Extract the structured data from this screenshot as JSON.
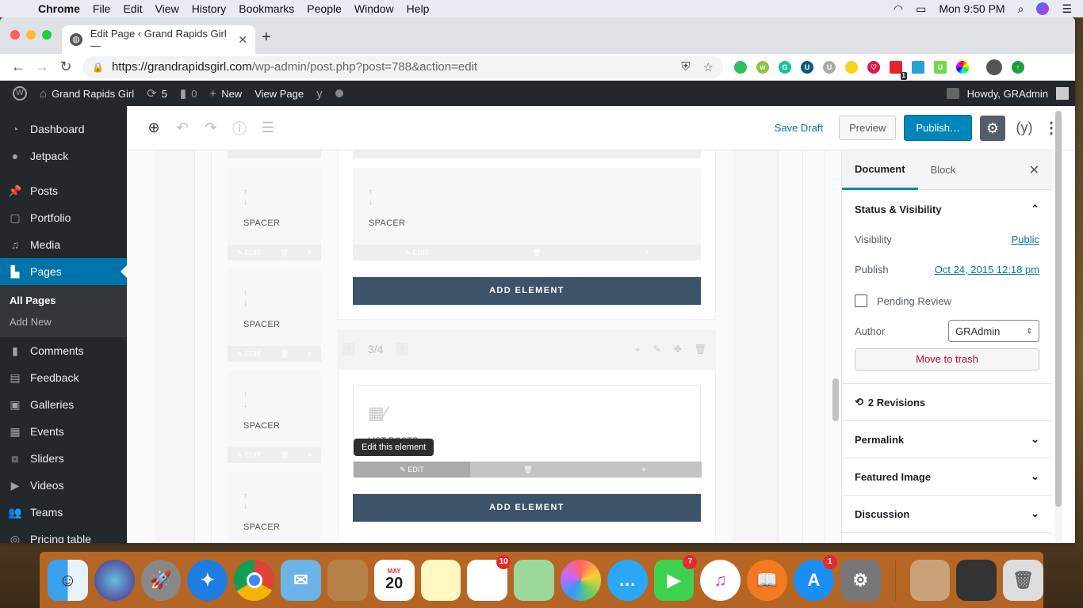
{
  "menubar": {
    "app": "Chrome",
    "items": [
      "File",
      "Edit",
      "View",
      "History",
      "Bookmarks",
      "People",
      "Window",
      "Help"
    ],
    "clock": "Mon 9:50 PM"
  },
  "browser": {
    "tab_title": "Edit Page ‹ Grand Rapids Girl —",
    "url_host": "https://grandrapidsgirl.com",
    "url_path": "/wp-admin/post.php?post=788&action=edit",
    "extension_badge": "1"
  },
  "adminbar": {
    "site_name": "Grand Rapids Girl",
    "updates": "5",
    "comments": "0",
    "new_label": "New",
    "view_page": "View Page",
    "howdy": "Howdy, GRAdmin"
  },
  "sidebar": {
    "items": [
      {
        "label": "Dashboard",
        "icon": "dashboard-icon"
      },
      {
        "label": "Jetpack",
        "icon": "jetpack-icon"
      },
      {
        "label": "Posts",
        "icon": "pin-icon"
      },
      {
        "label": "Portfolio",
        "icon": "portfolio-icon"
      },
      {
        "label": "Media",
        "icon": "media-icon"
      },
      {
        "label": "Pages",
        "icon": "pages-icon"
      },
      {
        "label": "Comments",
        "icon": "comment-icon"
      },
      {
        "label": "Feedback",
        "icon": "feedback-icon"
      },
      {
        "label": "Galleries",
        "icon": "gallery-icon"
      },
      {
        "label": "Events",
        "icon": "calendar-icon"
      },
      {
        "label": "Sliders",
        "icon": "slider-icon"
      },
      {
        "label": "Videos",
        "icon": "video-icon"
      },
      {
        "label": "Teams",
        "icon": "teams-icon"
      },
      {
        "label": "Pricing table",
        "icon": "pricing-icon"
      }
    ],
    "submenu": [
      "All Pages",
      "Add New"
    ]
  },
  "editor": {
    "save_draft": "Save Draft",
    "preview": "Preview",
    "publish": "Publish…"
  },
  "builder": {
    "spacer_label": "SPACER",
    "edit_label": "EDIT",
    "add_element": "ADD ELEMENT",
    "pager": "3/4",
    "list_posts": "LIST POSTS",
    "tooltip": "Edit this element"
  },
  "settings": {
    "tabs": [
      "Document",
      "Block"
    ],
    "status_title": "Status & Visibility",
    "visibility_label": "Visibility",
    "visibility_value": "Public",
    "publish_label": "Publish",
    "publish_value": "Oct 24, 2015 12:18 pm",
    "pending_review": "Pending Review",
    "author_label": "Author",
    "author_value": "GRAdmin",
    "move_to_trash": "Move to trash",
    "revisions": "2 Revisions",
    "panels": [
      "Permalink",
      "Featured Image",
      "Discussion"
    ]
  },
  "dock": {
    "calendar_month": "MAY",
    "calendar_day": "20",
    "badges": {
      "reminders": "10",
      "facetime": "7",
      "appstore": "1"
    }
  }
}
